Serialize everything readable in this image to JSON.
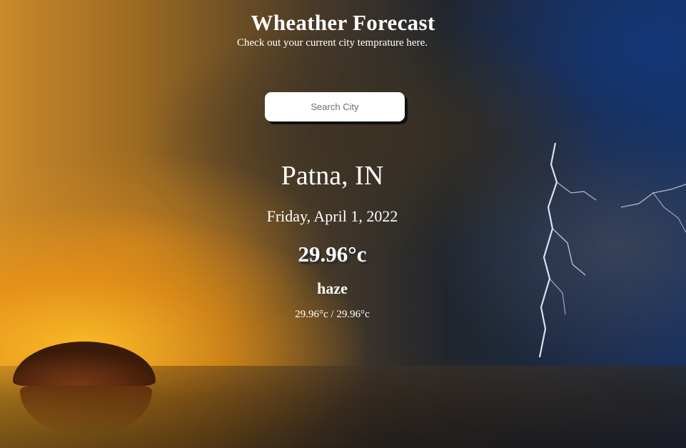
{
  "header": {
    "title": "Wheather Forecast",
    "subtitle": "Check out your current city temprature here."
  },
  "search": {
    "placeholder": "Search City",
    "value": ""
  },
  "weather": {
    "location": "Patna, IN",
    "date": "Friday, April 1, 2022",
    "temperature": "29.96°c",
    "condition": "haze",
    "min_max": "29.96°c / 29.96°c"
  },
  "background": {
    "description_colors": {
      "warm": "#e8a020",
      "storm": "#2a2a2a",
      "sky_blue": "#16305f"
    }
  }
}
